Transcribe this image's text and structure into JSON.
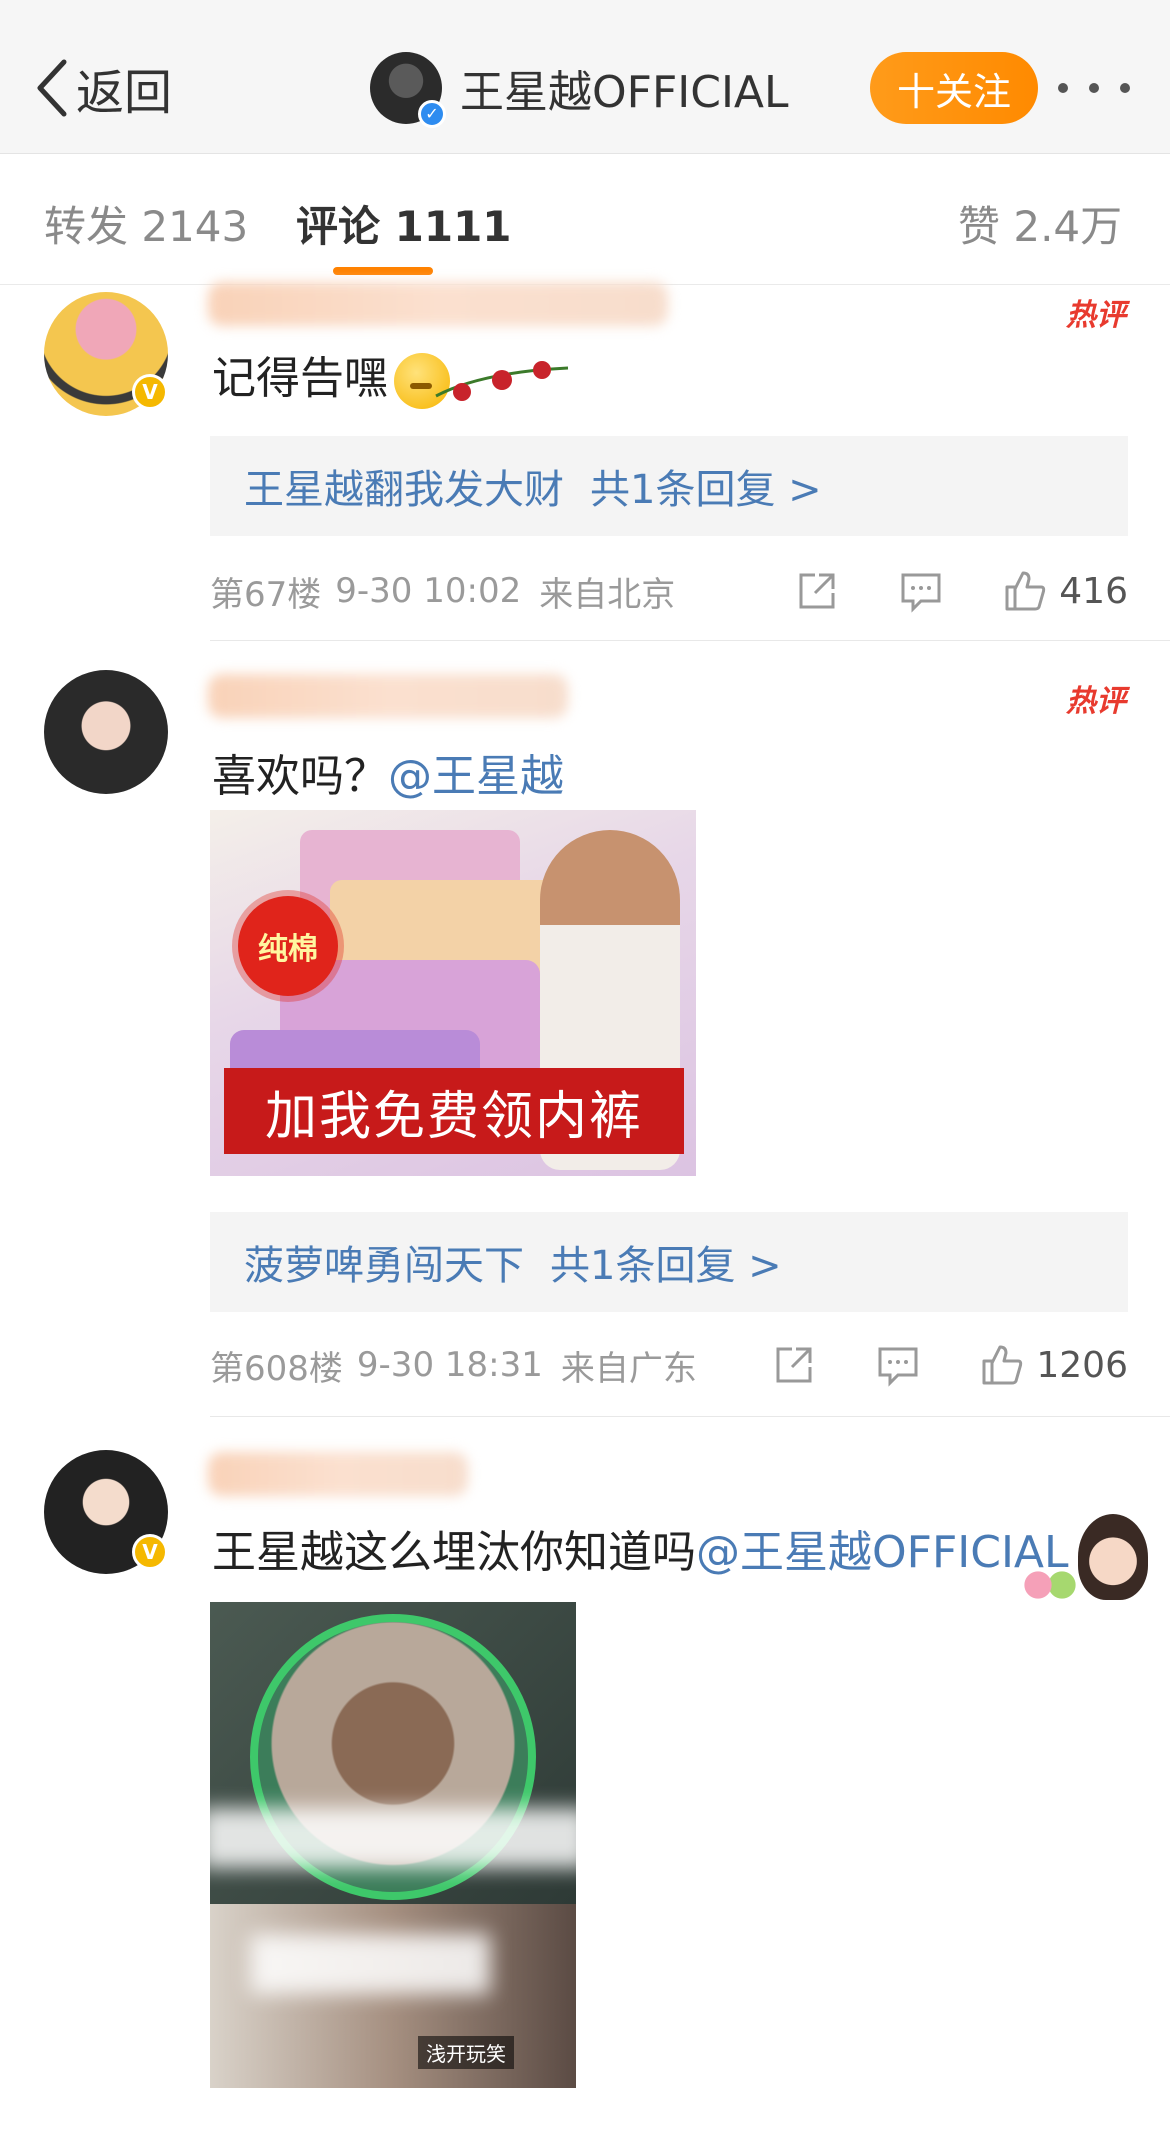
{
  "nav": {
    "back_label": "返回",
    "username": "王星越OFFICIAL",
    "follow_label": "十关注"
  },
  "tabs": {
    "repost": "转发 2143",
    "comment": "评论 1111",
    "like": "赞 2.4万"
  },
  "hot_label": "热评",
  "comments": [
    {
      "text": "记得告嘿",
      "reply_user": "王星越翻我发大财",
      "reply_count": "共1条回复 >",
      "floor": "第67楼",
      "time": "9-30 10:02",
      "location": "来自北京",
      "likes": "416"
    },
    {
      "text": "喜欢吗？",
      "mention": "@王星越",
      "image": {
        "badge": "纯棉",
        "banner": "加我免费领内裤"
      },
      "reply_user": "菠萝啤勇闯天下",
      "reply_count": "共1条回复 >",
      "floor": "第608楼",
      "time": "9-30 18:31",
      "location": "来自广东",
      "likes": "1206"
    },
    {
      "text": "王星越这么埋汰你知道吗",
      "mention": "@王星越OFFICIAL",
      "image": {
        "caption": "浅开玩笑"
      }
    }
  ],
  "colors": {
    "accent": "#ff8200",
    "link": "#4a7bb5",
    "hot": "#e83a2e"
  }
}
